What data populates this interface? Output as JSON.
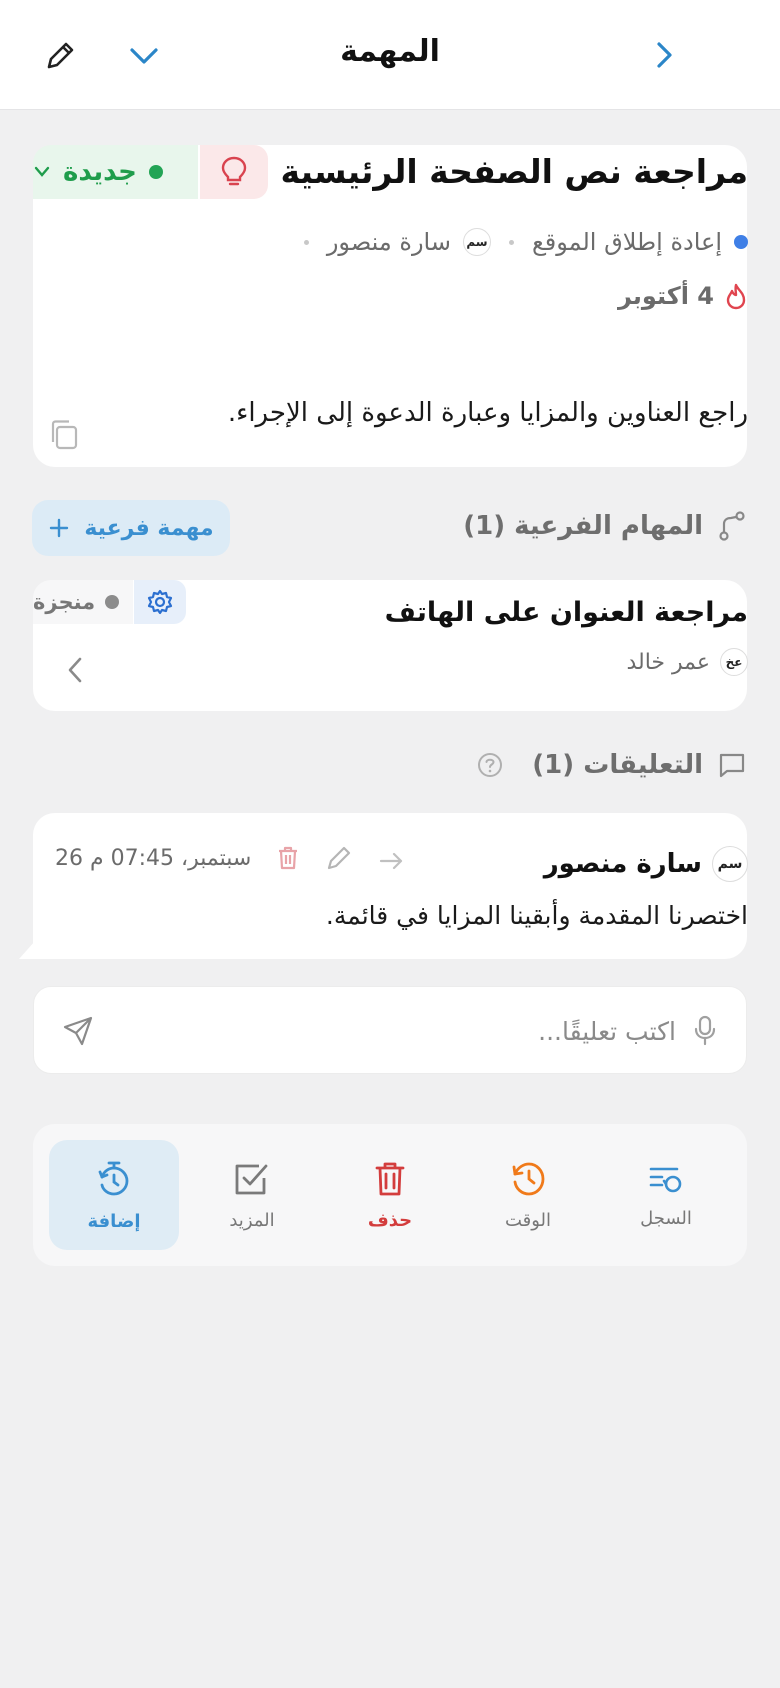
{
  "header": {
    "title": "المهمة"
  },
  "task": {
    "title": "مراجعة نص الصفحة الرئيسية",
    "status": "جديدة",
    "project": "إعادة إطلاق الموقع",
    "assignee_initials": "سم",
    "assignee": "سارة منصور",
    "due_date": "4 أكتوبر",
    "description": "راجع العناوين والمزايا وعبارة الدعوة إلى الإجراء."
  },
  "subtasks": {
    "label": "المهام الفرعية (1)",
    "add_button": "مهمة فرعية",
    "items": [
      {
        "title": "مراجعة العنوان على الهاتف",
        "status": "منجزة",
        "assignee_initials": "عخ",
        "assignee": "عمر خالد"
      }
    ]
  },
  "comments": {
    "label": "التعليقات (1)",
    "items": [
      {
        "author_initials": "سم",
        "author": "سارة منصور",
        "time": "26 سبتمبر، 07:45 م",
        "text": "اختصرنا المقدمة وأبقينا المزايا في قائمة."
      }
    ],
    "input_placeholder": "اكتب تعليقًا..."
  },
  "bottom_bar": {
    "items": [
      {
        "label": "السجل",
        "icon": "history-list-icon"
      },
      {
        "label": "الوقت",
        "icon": "clock-history-icon"
      },
      {
        "label": "حذف",
        "icon": "trash-icon"
      },
      {
        "label": "المزيد",
        "icon": "checkbox-icon"
      },
      {
        "label": "إضافة",
        "icon": "timer-add-icon"
      }
    ]
  },
  "colors": {
    "accent": "#3a8fd0",
    "status_new": "#1f9d4c",
    "danger": "#d33d3d",
    "time_orange": "#f07a1a",
    "background": "#f0f0f1"
  }
}
